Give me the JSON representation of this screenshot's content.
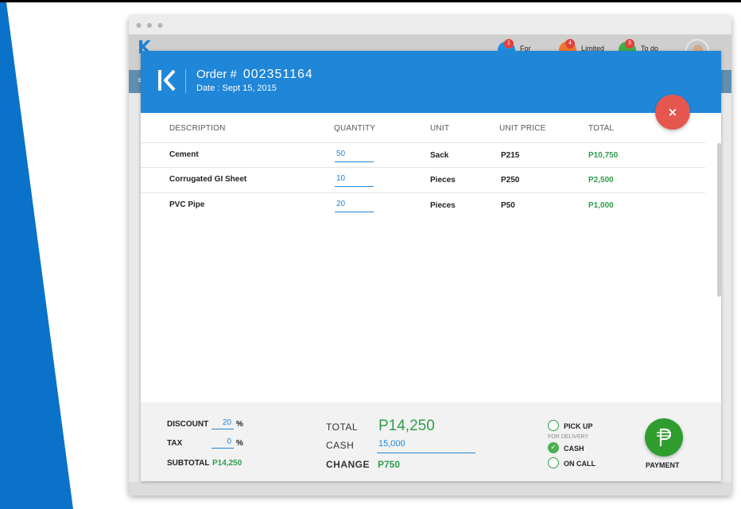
{
  "app": {
    "toolbar": [
      {
        "label": "For",
        "badge": "1",
        "color": "#1e90e0"
      },
      {
        "label": "Limited",
        "badge": "4",
        "color": "#f0782a"
      },
      {
        "label": "To do",
        "badge": "3",
        "color": "#3fae49"
      }
    ]
  },
  "modal": {
    "order_label": "Order #",
    "order_number": "002351164",
    "date": "Date : Sept 15, 2015",
    "close_symbol": "×",
    "columns": [
      "DESCRIPTION",
      "QUANTITY",
      "UNIT",
      "UNIT PRICE",
      "TOTAL"
    ],
    "items": [
      {
        "description": "Cement",
        "quantity": "50",
        "unit": "Sack",
        "unit_price": "P215",
        "total": "P10,750"
      },
      {
        "description": "Corrugated GI Sheet",
        "quantity": "10",
        "unit": "Pieces",
        "unit_price": "P250",
        "total": "P2,500"
      },
      {
        "description": "PVC Pipe",
        "quantity": "20",
        "unit": "Pieces",
        "unit_price": "P50",
        "total": "P1,000"
      }
    ]
  },
  "footer": {
    "discount_label": "DISCOUNT",
    "discount_value": "20",
    "tax_label": "TAX",
    "tax_value": "0",
    "percent": "%",
    "subtotal_label": "SUBTOTAL",
    "subtotal_value": "P14,250",
    "total_label": "TOTAL",
    "total_value": "P14,250",
    "cash_label": "CASH",
    "cash_value": "15,000",
    "change_label": "CHANGE",
    "change_value": "P750",
    "options": {
      "pickup": "PICK UP",
      "delivery_group": "FOR DELIVERY",
      "cash": "CASH",
      "on_call": "ON CALL",
      "selected": "CASH"
    },
    "payment_label": "PAYMENT"
  },
  "colors": {
    "header_blue": "#1f86d8",
    "accent_green": "#2e9d4e",
    "close_red": "#e5574e",
    "side_stripe": "#0a72c8"
  }
}
